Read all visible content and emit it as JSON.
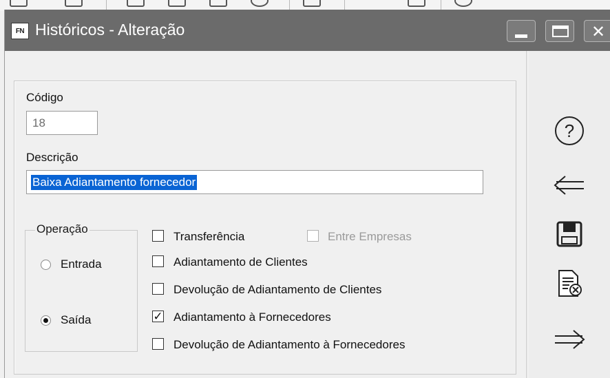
{
  "window": {
    "app_icon": "FN",
    "title": "Históricos - Alteração"
  },
  "form": {
    "codigo": {
      "label": "Código",
      "value": "18"
    },
    "descricao": {
      "label": "Descrição",
      "value": "Baixa Adiantamento fornecedor"
    },
    "operacao": {
      "legend": "Operação",
      "options": [
        {
          "label": "Entrada",
          "selected": false
        },
        {
          "label": "Saída",
          "selected": true
        }
      ]
    },
    "options": [
      {
        "label": "Transferência",
        "checked": false,
        "enabled": true
      },
      {
        "label": "Entre Empresas",
        "checked": false,
        "enabled": false
      },
      {
        "label": "Adiantamento de Clientes",
        "checked": false,
        "enabled": true
      },
      {
        "label": "Devolução de Adiantamento de Clientes",
        "checked": false,
        "enabled": true
      },
      {
        "label": "Adiantamento à Fornecedores",
        "checked": true,
        "enabled": true
      },
      {
        "label": "Devolução de Adiantamento à Fornecedores",
        "checked": false,
        "enabled": true
      }
    ]
  },
  "side_actions": [
    "help-icon",
    "back-arrow-icon",
    "save-icon",
    "cancel-document-icon",
    "forward-arrow-icon"
  ],
  "colors": {
    "title_bar": "#6b6b6b",
    "selection": "#0a64d4"
  }
}
